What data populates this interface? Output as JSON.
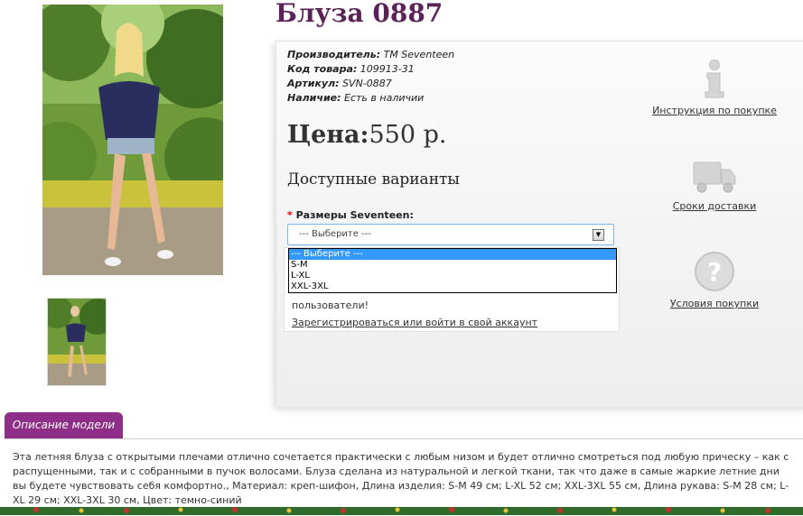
{
  "product": {
    "title": "Блуза 0887",
    "meta": [
      {
        "label": "Производитель:",
        "value": "TM Seventeen"
      },
      {
        "label": "Код товара:",
        "value": "109913-31"
      },
      {
        "label": "Артикул:",
        "value": "SVN-0887"
      },
      {
        "label": "Наличие:",
        "value": "Есть в наличии"
      }
    ],
    "price_label": "Цена:",
    "price_value": "550 р.",
    "variants_heading": "Доступные варианты",
    "size_required_mark": "*",
    "size_label": "Размеры Seventeen:",
    "size_select": {
      "value": "--- Выберите ---",
      "options": [
        "--- Выберите ---",
        "S-M",
        "L-XL",
        "XXL-3XL"
      ]
    },
    "notice_text": "пользователи!",
    "notice_link": "Зарегистрироваться или войти в свой аккаунт"
  },
  "side_links": [
    {
      "label": "Инструкция по покупке",
      "icon": "info-icon"
    },
    {
      "label": "Сроки доставки",
      "icon": "truck-icon"
    },
    {
      "label": "Условия покупки",
      "icon": "question-icon"
    }
  ],
  "description": {
    "tab_label": "Описание модели",
    "text": "Эта летняя блуза с открытыми плечами отлично сочетается практически с любым низом и будет отлично смотреться под любую прическу – как с распущенными, так и с собранными в пучок волосами. Блуза сделана из натуральной и легкой ткани, так что даже в самые жаркие летние дни вы будете чувствовать себя комфортно., Материал: креп-шифон, Длина изделия: S-M 49 см; L-XL 52 см; XXL-3XL 55 см, Длина рукава: S-M 28 см; L-XL 29 см; XXL-3XL 30 см, Цвет: темно-синий"
  },
  "colors": {
    "title": "#5b2257",
    "tab": "#8e2e88",
    "select_border": "#7eb4ea",
    "selected_option": "#3399ff"
  }
}
